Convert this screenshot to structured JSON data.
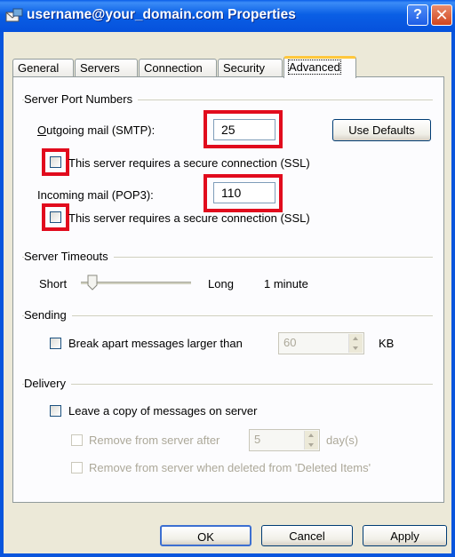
{
  "window": {
    "title": "username@your_domain.com Properties",
    "help": "?",
    "close": "✕"
  },
  "tabs": [
    {
      "label": "General"
    },
    {
      "label": "Servers"
    },
    {
      "label": "Connection"
    },
    {
      "label": "Security"
    },
    {
      "label": "Advanced"
    }
  ],
  "ports": {
    "group_title": "Server Port Numbers",
    "outgoing_label": "Outgoing mail (SMTP):",
    "outgoing_value": "25",
    "use_defaults": "Use Defaults",
    "ssl_smtp_label": "This server requires a secure connection (SSL)",
    "incoming_label": "Incoming mail (POP3):",
    "incoming_value": "110",
    "ssl_pop3_label": "This server requires a secure connection (SSL)"
  },
  "timeouts": {
    "group_title": "Server Timeouts",
    "short_label": "Short",
    "long_label": "Long",
    "value": "1 minute"
  },
  "sending": {
    "group_title": "Sending",
    "break_label": "Break apart messages larger than",
    "size_value": "60",
    "unit": "KB"
  },
  "delivery": {
    "group_title": "Delivery",
    "leave_copy_label": "Leave a copy of messages on server",
    "remove_after_label": "Remove from server after",
    "days_value": "5",
    "days_unit": "day(s)",
    "remove_deleted_label": "Remove from server when deleted from 'Deleted Items'"
  },
  "buttons": {
    "ok": "OK",
    "cancel": "Cancel",
    "apply": "Apply"
  },
  "colors": {
    "highlight": "#e10b1d",
    "title_bar": "#0855dd",
    "dialog": "#ece9d8"
  }
}
